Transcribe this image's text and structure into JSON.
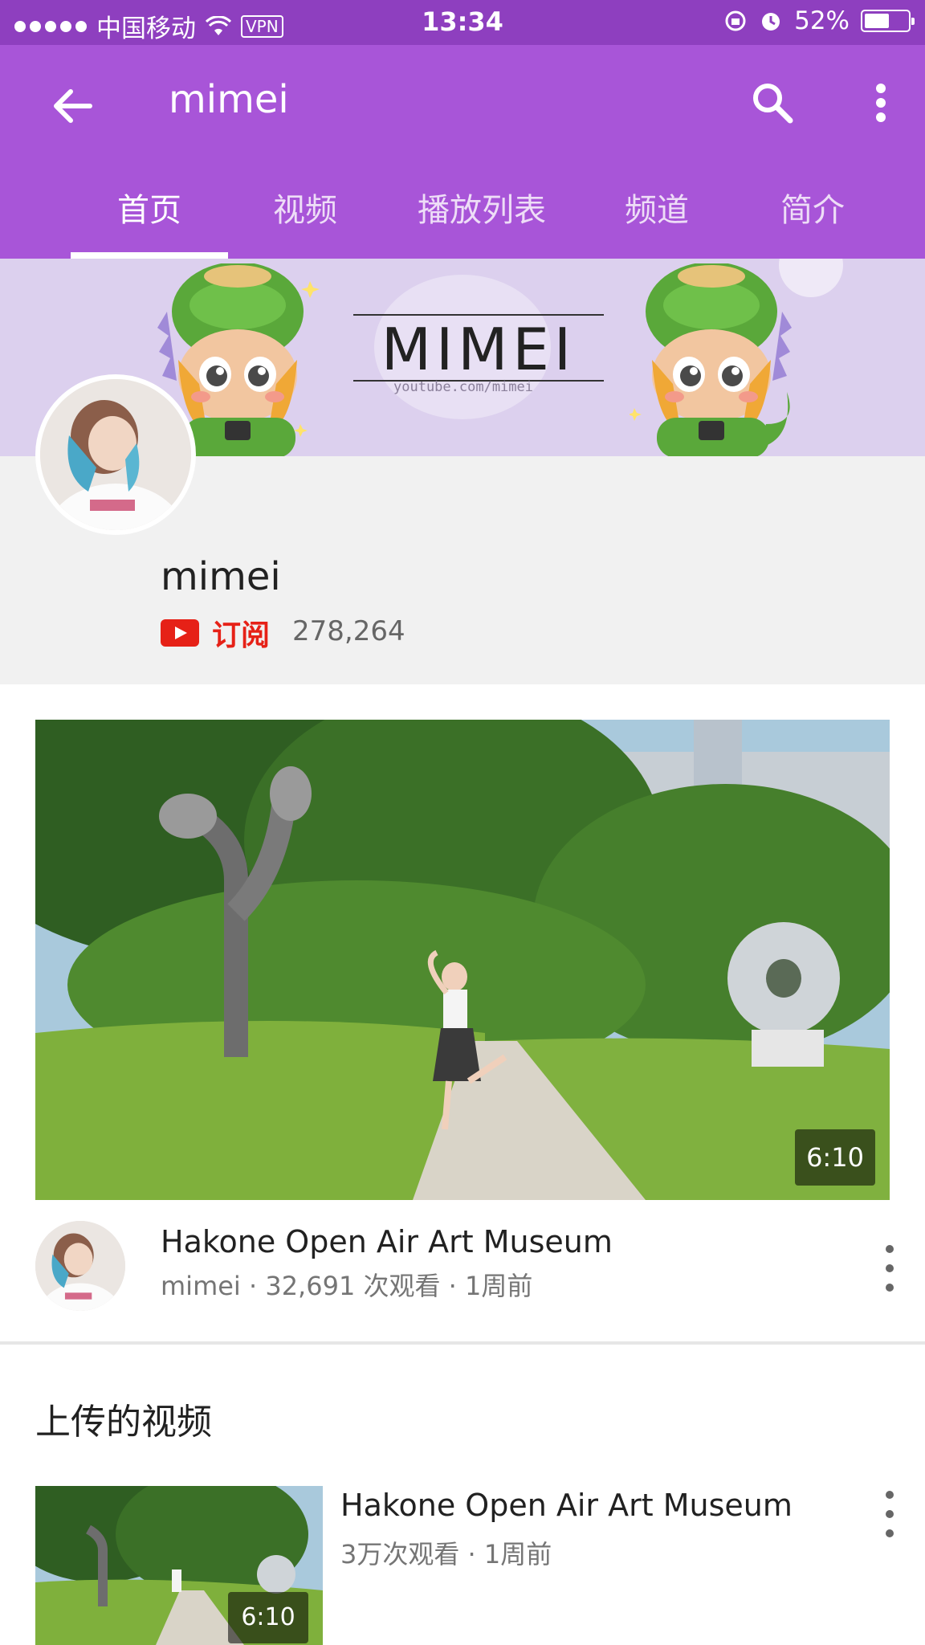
{
  "status_bar": {
    "carrier": "中国移动",
    "vpn": "VPN",
    "time": "13:34",
    "battery": "52%"
  },
  "app_bar": {
    "title": "mimei",
    "back_icon": "arrow-left-icon",
    "search_icon": "search-icon",
    "more_icon": "more-vert-icon"
  },
  "tabs": [
    {
      "label": "首页",
      "active": true
    },
    {
      "label": "视频",
      "active": false
    },
    {
      "label": "播放列表",
      "active": false
    },
    {
      "label": "频道",
      "active": false
    },
    {
      "label": "简介",
      "active": false
    }
  ],
  "banner": {
    "logo_text": "MIMEI",
    "url_text": "youtube.com/mimei"
  },
  "channel": {
    "name": "mimei",
    "subscribe_label": "订阅",
    "subscriber_count": "278,264"
  },
  "featured_video": {
    "duration": "6:10",
    "title": "Hakone Open Air Art Museum",
    "channel": "mimei",
    "views": "32,691 次观看",
    "age": "1周前"
  },
  "uploads": {
    "section_title": "上传的视频",
    "items": [
      {
        "title": "Hakone Open Air Art Museum",
        "views": "3万次观看",
        "age": "1周前",
        "duration": "6:10"
      }
    ]
  },
  "colors": {
    "status_bar": "#8e3fbf",
    "app_bar": "#a855d8",
    "subscribe_red": "#e62117",
    "banner_bg": "#dcd0ee"
  }
}
